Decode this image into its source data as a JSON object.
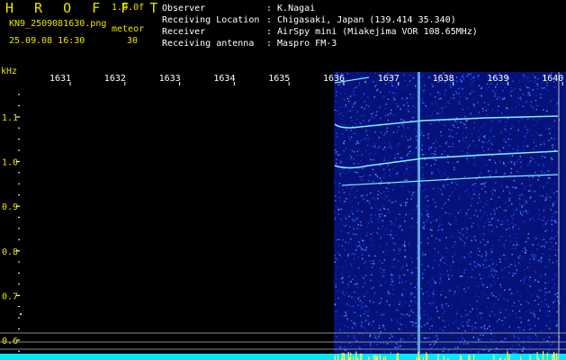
{
  "header": {
    "app_title": "H R O F F T",
    "version": "1.0.0f",
    "filename": "KN9_2509081630.png",
    "mode": "meteor",
    "datetime": "25.09.08 16:30",
    "count": "30"
  },
  "info": [
    {
      "key": "Observer",
      "value": ": K.Nagai"
    },
    {
      "key": "Receiving Location",
      "value": ": Chigasaki, Japan (139.414 35.340)"
    },
    {
      "key": "Receiver",
      "value": ": AirSpy mini (Miakejima VOR 108.65MHz)"
    },
    {
      "key": "Receiving antenna",
      "value": ": Maspro FM-3"
    }
  ],
  "axes": {
    "y_unit": "kHz",
    "y_ticks": [
      "1.1",
      "1.0",
      "0.9",
      "0.8",
      "0.7",
      "0.6"
    ],
    "x_ticks": [
      "1631",
      "1632",
      "1633",
      "1634",
      "1635",
      "1636",
      "1637",
      "1638",
      "1639",
      "1640"
    ]
  },
  "colors": {
    "label_yellow": "#e6e600",
    "text_white": "#ffffff",
    "noise_blue": "#0a1e9a",
    "signal_cyan": "#7ff0ff"
  }
}
